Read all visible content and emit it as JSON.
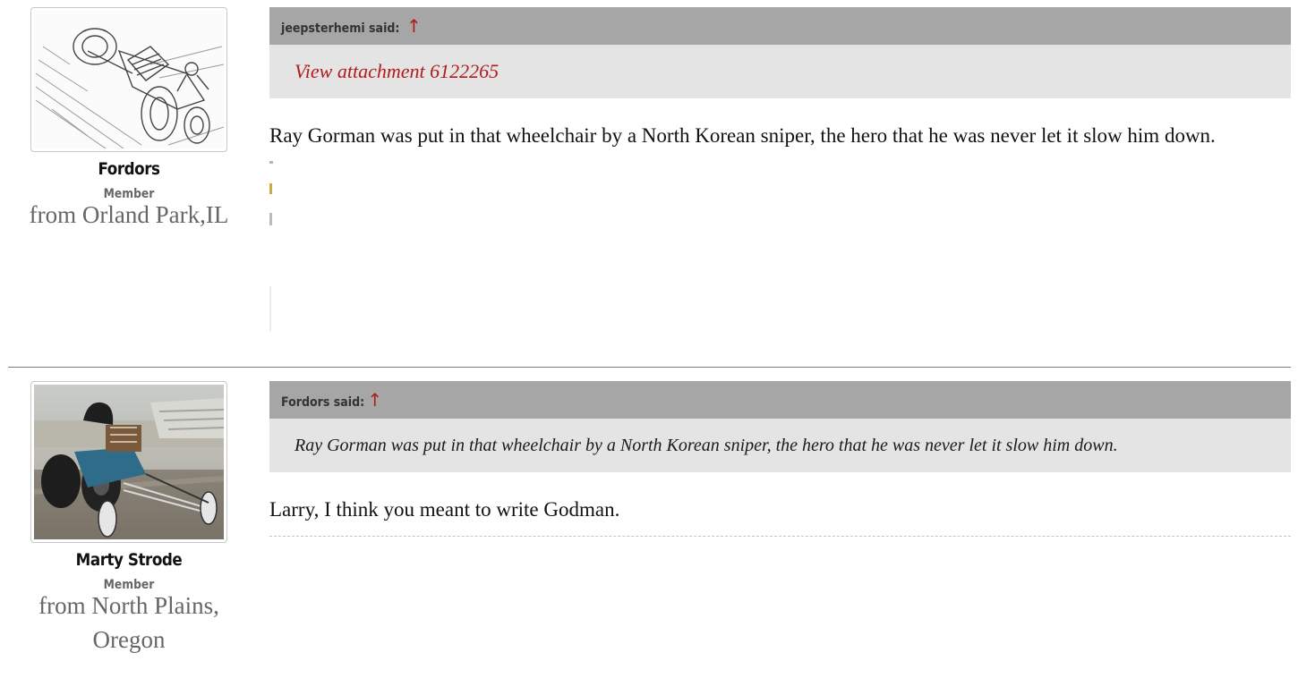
{
  "posts": [
    {
      "author": {
        "name": "Fordors",
        "title": "Member",
        "location": "from Orland Park,IL",
        "avatar": "race-car-sketch-avatar"
      },
      "quote": {
        "attribution": "jeepsterhemi said:",
        "arrow": "↑",
        "link_text": "View attachment 6122265"
      },
      "message": "Ray Gorman was put in that wheelchair by a North Korean sniper, the hero that he was never let it slow him down."
    },
    {
      "author": {
        "name": "Marty Strode",
        "title": "Member",
        "location": "from North Plains, Oregon",
        "avatar": "dragster-photo-avatar"
      },
      "quote": {
        "attribution": "Fordors said:",
        "arrow": "↑",
        "text": "Ray Gorman was put in that wheelchair by a North Korean sniper, the hero that he was never let it slow him down."
      },
      "message": "Larry, I think you meant to write Godman."
    }
  ],
  "colors": {
    "link": "#b01c1c",
    "quote_header_bg": "#a6a6a6",
    "quote_body_bg": "#e4e4e4",
    "muted_text": "#666666"
  }
}
